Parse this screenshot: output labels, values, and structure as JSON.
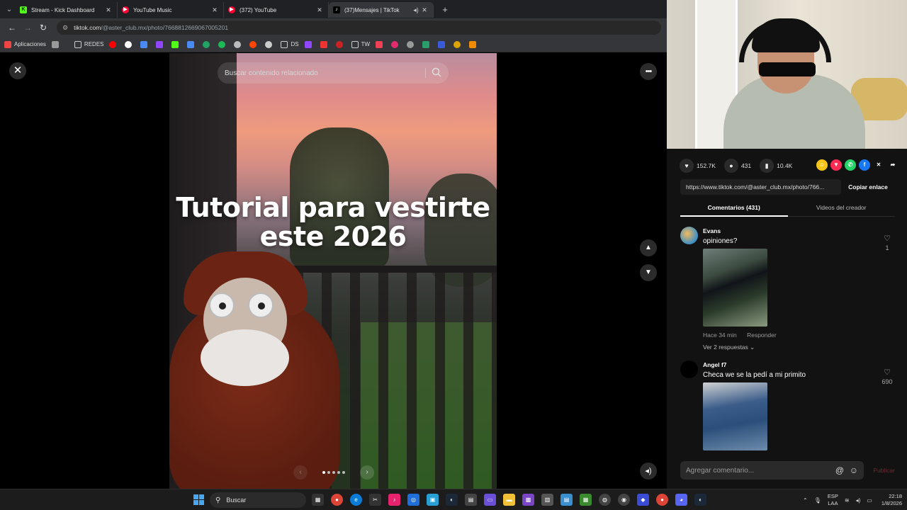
{
  "browser": {
    "tabs": [
      {
        "title": "Stream - Kick Dashboard",
        "favicon": "kick-icon",
        "color": "#53fc18",
        "glyph": "K"
      },
      {
        "title": "YouTube Music",
        "favicon": "youtube-music-icon",
        "color": "#ff0033",
        "glyph": "▶"
      },
      {
        "title": "(372) YouTube",
        "favicon": "youtube-icon",
        "color": "#ff0033",
        "glyph": "▶"
      },
      {
        "title": "(37)Mensajes | TikTok",
        "favicon": "tiktok-icon",
        "color": "#ffffff",
        "glyph": "♪"
      }
    ],
    "url_host": "tiktok.com",
    "url_path": "/@aster_club.mx/photo/7668812669067005201",
    "bookmarks": {
      "apps_label": "Aplicaciones",
      "folder_redes": "REDES",
      "folder_ds": "DS",
      "folder_tw": "TW"
    }
  },
  "viewer": {
    "search_placeholder": "Buscar contenido relacionado",
    "overlay_text": "Tutorial para vestirte este 2026",
    "pager": {
      "total": 5,
      "current": 1
    }
  },
  "panel": {
    "likes": "152.7K",
    "comments": "431",
    "saves": "10.4K",
    "share_targets": [
      {
        "icon": "friends-share-icon",
        "color": "#f5c518",
        "glyph": "☺"
      },
      {
        "icon": "repost-icon",
        "color": "#fe2c55",
        "glyph": "▼"
      },
      {
        "icon": "whatsapp-icon",
        "color": "#25d366",
        "glyph": "✆"
      },
      {
        "icon": "facebook-icon",
        "color": "#1877f2",
        "glyph": "f"
      },
      {
        "icon": "x-icon",
        "color": "#121212",
        "glyph": "✕"
      },
      {
        "icon": "share-arrow-icon",
        "color": "#121212",
        "glyph": "➦"
      }
    ],
    "link_text": "https://www.tiktok.com/@aster_club.mx/photo/766...",
    "copy_label": "Copiar enlace",
    "tab_comments": "Comentarios (431)",
    "tab_videos": "Videos del creador",
    "comment_list": [
      {
        "name": "Evans",
        "text": "opiniones?",
        "likes": "1",
        "time": "Hace 34 min",
        "reply": "Responder",
        "replies": "Ver 2 respuestas"
      },
      {
        "name": "Angel f7",
        "text": "Checa we se la pedí a mi primito",
        "likes": "690"
      }
    ],
    "composer_placeholder": "Agregar comentario...",
    "publish_label": "Publicar"
  },
  "taskbar": {
    "search_label": "Buscar",
    "lang_top": "ESP",
    "lang_bottom": "LAA",
    "time": "22:18",
    "date": "1/8/2026"
  },
  "colors": {
    "accent_tiktok": "#fe2c55",
    "panel_bg": "#121212"
  }
}
